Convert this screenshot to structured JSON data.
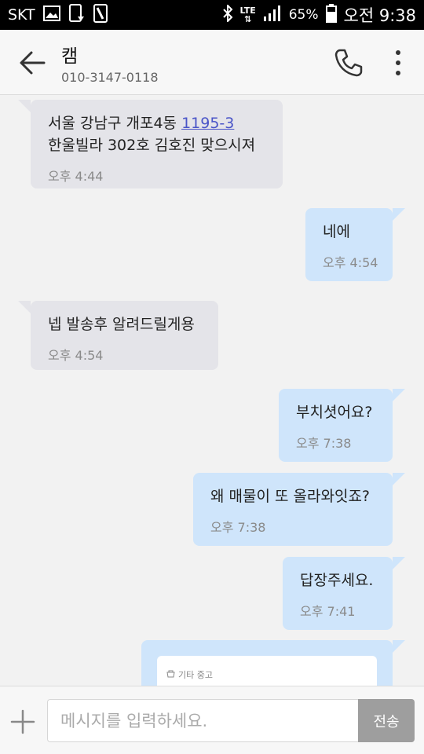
{
  "status_bar": {
    "carrier": "SKT",
    "network": "LTE",
    "battery": "65%",
    "time": "오전 9:38",
    "left_icons": [
      "gallery-icon",
      "device-icon",
      "sim-card-icon"
    ],
    "right_icons": [
      "bluetooth-icon",
      "lte-icon",
      "signal-icon",
      "battery-icon"
    ]
  },
  "header": {
    "contact_name": "캠",
    "phone": "010-3147-0118",
    "icons": [
      "back-arrow-icon",
      "phone-icon",
      "more-vertical-icon"
    ]
  },
  "messages": [
    {
      "dir": "in",
      "text_line1": "서울 강남구 개포4동 ",
      "link": "1195-3",
      "text_line2": "한울빌라 302호 김호진 맞으시져",
      "time": "오후 4:44"
    },
    {
      "dir": "out",
      "text": "네에",
      "time": "오후 4:54"
    },
    {
      "dir": "in",
      "text": "넵 발송후 알려드릴게용",
      "time": "오후 4:54"
    },
    {
      "dir": "out",
      "text": "부치셧어요?",
      "time": "오후 7:38"
    },
    {
      "dir": "out",
      "text": "왜 매물이 또 올라와잇죠?",
      "time": "오후 7:38"
    },
    {
      "dir": "out",
      "text": "답장주세요.",
      "time": "오후 7:41"
    },
    {
      "dir": "out",
      "card_tag": "기타 중고",
      "card_icon": "shop-icon"
    }
  ],
  "input_bar": {
    "placeholder": "메시지를 입력하세요.",
    "value": "",
    "send_label": "전송",
    "icons": [
      "plus-icon"
    ]
  },
  "colors": {
    "incoming_bubble": "#e4e4e9",
    "outgoing_bubble": "#cfe5fb",
    "link": "#4a55c8",
    "send_button": "#9e9e9e"
  }
}
